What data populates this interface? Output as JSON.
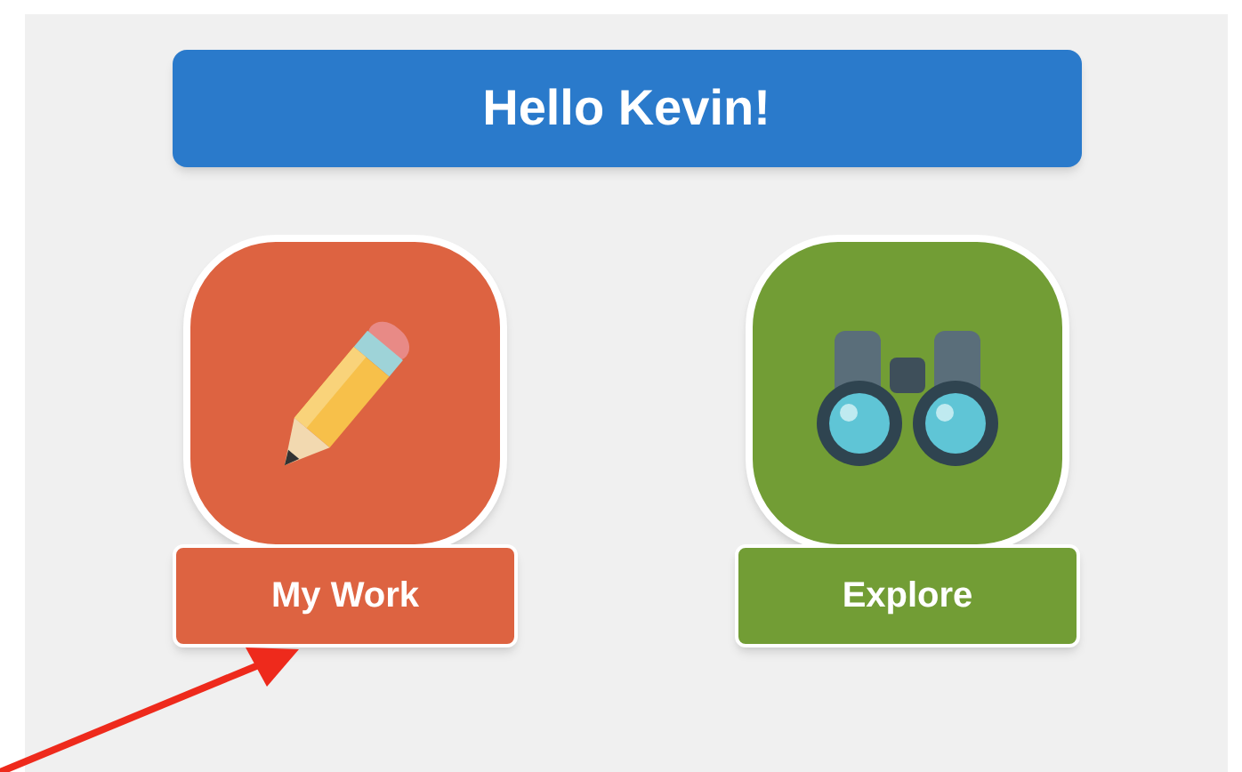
{
  "header": {
    "title": "Hello Kevin!"
  },
  "tiles": [
    {
      "label": "My Work",
      "kind": "pencil",
      "color": "#dd6341"
    },
    {
      "label": "Explore",
      "kind": "binoculars",
      "color": "#729d35"
    }
  ]
}
